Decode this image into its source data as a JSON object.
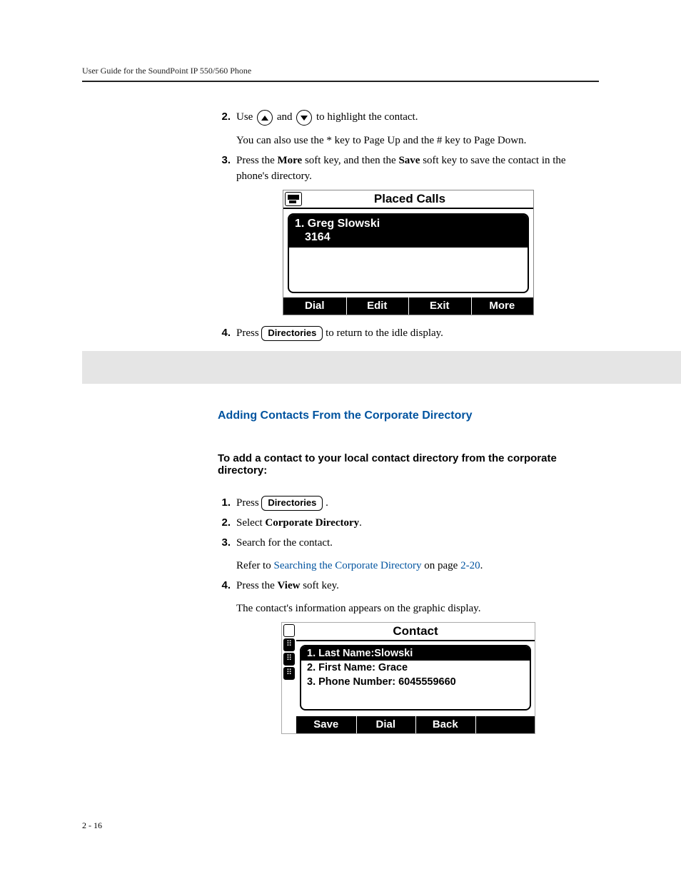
{
  "header": {
    "running": "User Guide for the SoundPoint IP 550/560 Phone"
  },
  "steps_a": {
    "s2_num": "2.",
    "s2_pre": "Use ",
    "s2_mid": " and ",
    "s2_post": " to highlight the contact.",
    "s2_extra": "You can also use the * key to Page Up and the # key to Page Down.",
    "s3_num": "3.",
    "s3_pre": "Press the ",
    "s3_b1": "More",
    "s3_mid": " soft key, and then the ",
    "s3_b2": "Save",
    "s3_post": " soft key to save the contact in the phone's directory.",
    "s4_num": "4.",
    "s4_pre": "Press ",
    "s4_btn": "Directories",
    "s4_post": " to return to the idle display."
  },
  "screen1": {
    "title": "Placed Calls",
    "row1_line1": "1. Greg Slowski",
    "row1_line2": "3164",
    "softkeys": {
      "k1": "Dial",
      "k2": "Edit",
      "k3": "Exit",
      "k4": "More"
    }
  },
  "section": {
    "h3": "Adding Contacts From the Corporate Directory",
    "leadin": "To add a contact to your local contact directory from the corporate directory:"
  },
  "steps_b": {
    "s1_num": "1.",
    "s1_pre": "Press ",
    "s1_btn": "Directories",
    "s1_post": ".",
    "s2_num": "2.",
    "s2_pre": "Select ",
    "s2_b": "Corporate Directory",
    "s2_post": ".",
    "s3_num": "3.",
    "s3_text": "Search for the contact.",
    "s3_ref_pre": "Refer to ",
    "s3_ref_link": "Searching the Corporate Directory",
    "s3_ref_mid": " on page ",
    "s3_ref_page": "2-20",
    "s3_ref_post": ".",
    "s4_num": "4.",
    "s4_pre": "Press the ",
    "s4_b": "View",
    "s4_post": " soft key.",
    "s4_extra": "The contact's information appears on the graphic display."
  },
  "screen2": {
    "title": "Contact",
    "row1": "1. Last Name:Slowski",
    "row2": "2. First Name: Grace",
    "row3": "3. Phone Number: 6045559660",
    "softkeys": {
      "k1": "Save",
      "k2": "Dial",
      "k3": "Back"
    }
  },
  "footer": {
    "pagenum": "2 - 16"
  }
}
